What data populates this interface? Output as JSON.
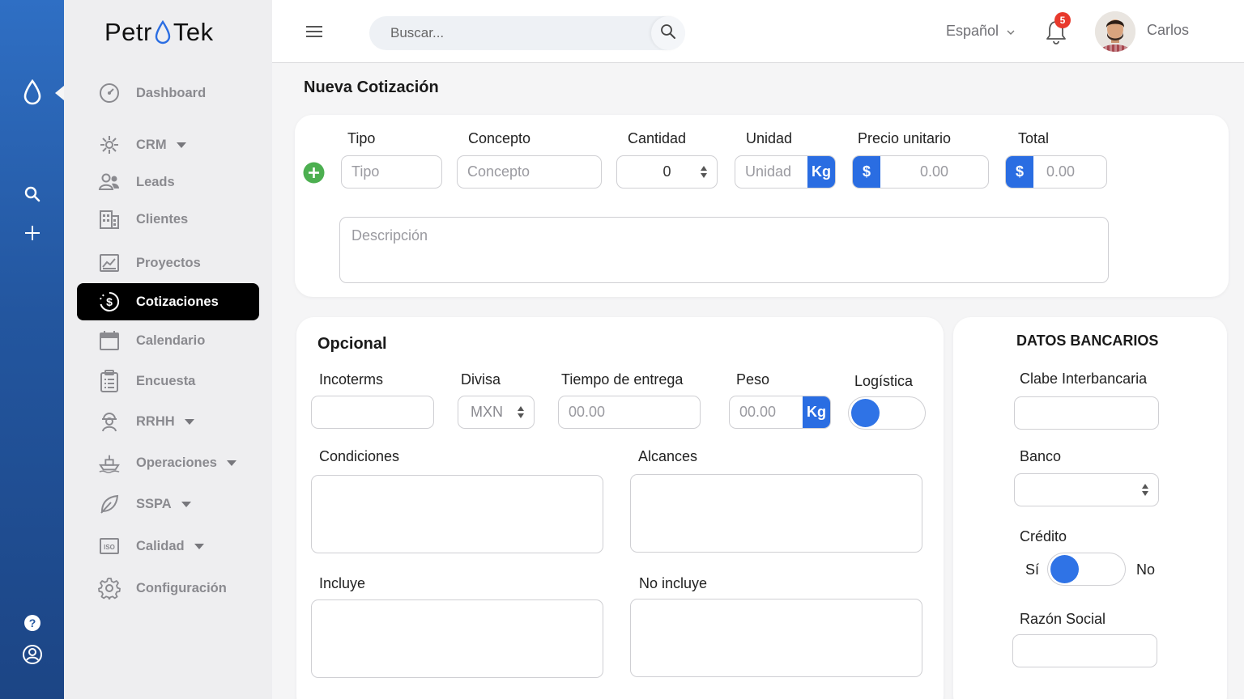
{
  "brand": {
    "left": "Petr",
    "right": "Tek"
  },
  "sidebar": {
    "items": [
      {
        "label": "Dashboard",
        "icon": "gauge-icon"
      },
      {
        "label": "CRM",
        "icon": "network-icon",
        "caret": true
      },
      {
        "label": "Leads",
        "icon": "users-icon"
      },
      {
        "label": "Clientes",
        "icon": "building-icon"
      },
      {
        "label": "Proyectos",
        "icon": "chart-image-icon"
      },
      {
        "label": "Cotizaciones",
        "icon": "dollar-cycle-icon",
        "active": true
      },
      {
        "label": "Calendario",
        "icon": "calendar-icon"
      },
      {
        "label": "Encuesta",
        "icon": "clipboard-icon"
      },
      {
        "label": "RRHH",
        "icon": "worker-icon",
        "caret": true
      },
      {
        "label": "Operaciones",
        "icon": "ship-icon",
        "caret": true
      },
      {
        "label": "SSPA",
        "icon": "leaf-icon",
        "caret": true
      },
      {
        "label": "Calidad",
        "icon": "iso-icon",
        "caret": true
      },
      {
        "label": "Configuración",
        "icon": "gear-icon"
      }
    ]
  },
  "topbar": {
    "search_placeholder": "Buscar...",
    "language": "Español",
    "notifications": "5",
    "user": "Carlos"
  },
  "page": {
    "title": "Nueva Cotización"
  },
  "item_form": {
    "tipo_label": "Tipo",
    "tipo_placeholder": "Tipo",
    "concepto_label": "Concepto",
    "concepto_placeholder": "Concepto",
    "cantidad_label": "Cantidad",
    "cantidad_value": "0",
    "unidad_label": "Unidad",
    "unidad_placeholder": "Unidad",
    "unidad_suffix": "Kg",
    "precio_label": "Precio unitario",
    "precio_prefix": "$",
    "precio_placeholder": "0.00",
    "total_label": "Total",
    "total_prefix": "$",
    "total_placeholder": "0.00",
    "descripcion_placeholder": "Descripción"
  },
  "optional": {
    "title": "Opcional",
    "incoterms_label": "Incoterms",
    "divisa_label": "Divisa",
    "divisa_value": "MXN",
    "tiempo_label": "Tiempo de entrega",
    "tiempo_placeholder": "00.00",
    "peso_label": "Peso",
    "peso_placeholder": "00.00",
    "peso_suffix": "Kg",
    "logistica_label": "Logística",
    "condiciones_label": "Condiciones",
    "alcances_label": "Alcances",
    "incluye_label": "Incluye",
    "no_incluye_label": "No incluye"
  },
  "bank": {
    "title": "DATOS BANCARIOS",
    "clabe_label": "Clabe Interbancaria",
    "banco_label": "Banco",
    "credito_label": "Crédito",
    "si_label": "Sí",
    "no_label": "No",
    "razon_label": "Razón Social"
  },
  "colors": {
    "accent": "#2a6de2",
    "rail_top": "#2f6fc4",
    "rail_bottom": "#1c4585",
    "add": "#4caf50"
  }
}
